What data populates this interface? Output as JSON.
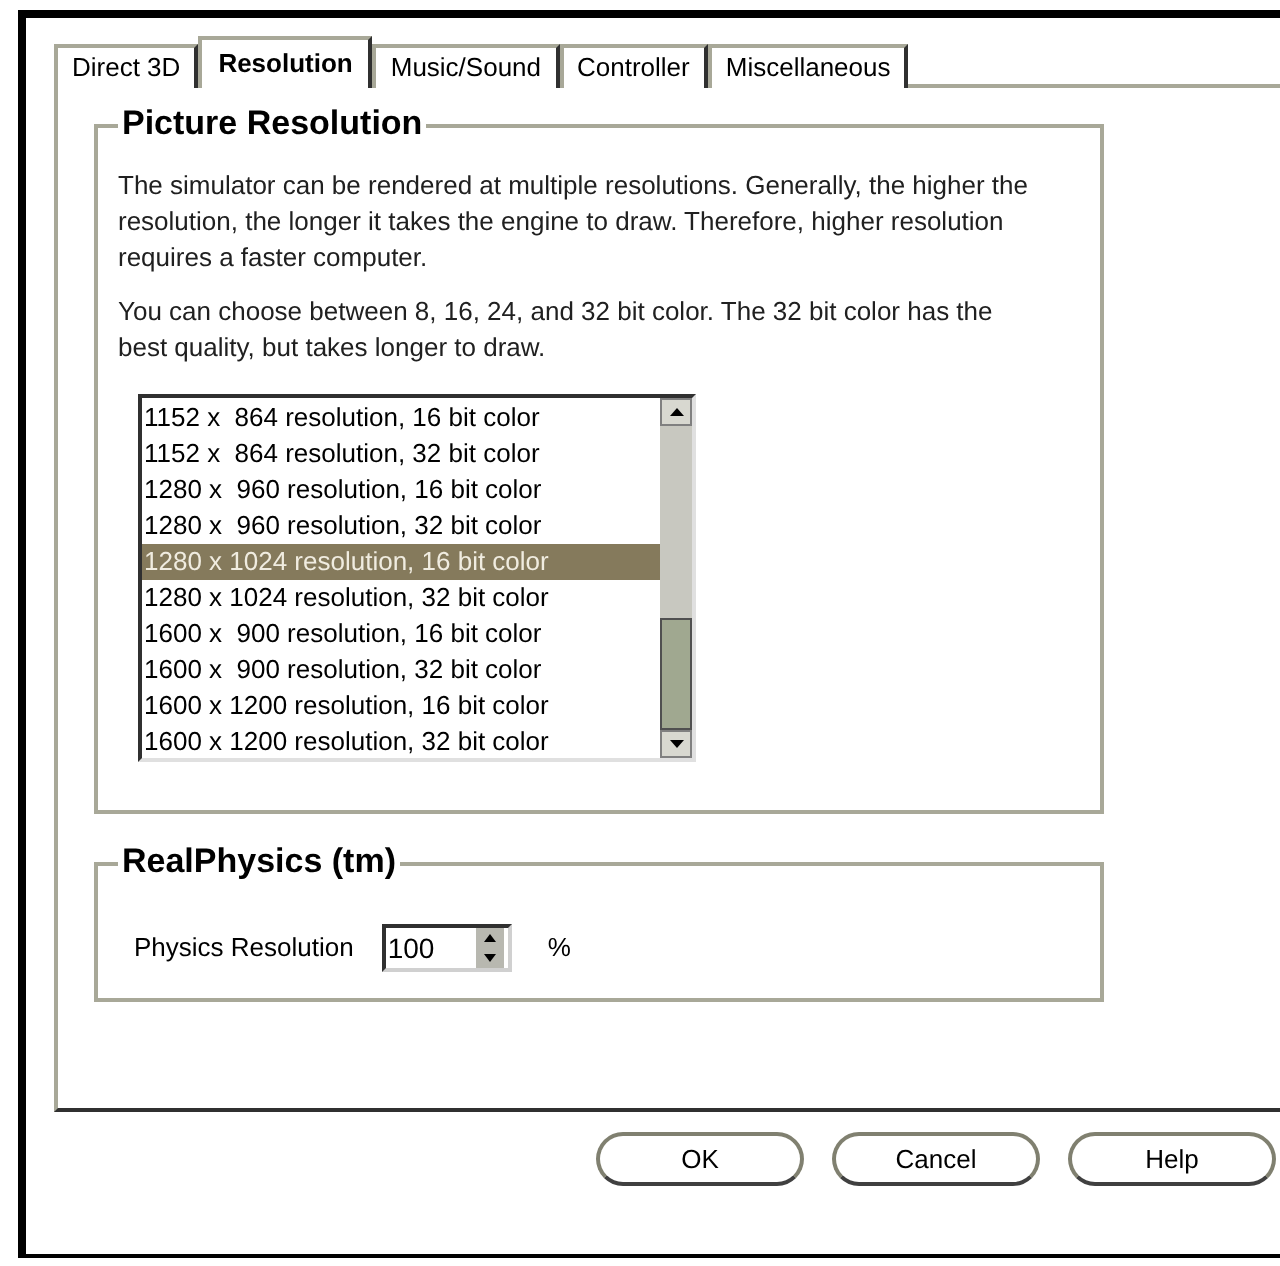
{
  "tabs": [
    {
      "label": "Direct 3D",
      "selected": false
    },
    {
      "label": "Resolution",
      "selected": true
    },
    {
      "label": "Music/Sound",
      "selected": false
    },
    {
      "label": "Controller",
      "selected": false
    },
    {
      "label": "Miscellaneous",
      "selected": false
    }
  ],
  "picture_resolution": {
    "title": "Picture Resolution",
    "paragraphs": [
      "The simulator can be rendered at multiple resolutions.  Generally, the higher the resolution, the longer it takes the engine to draw.  Therefore, higher resolution requires a faster computer.",
      "You can choose between 8, 16, 24, and 32  bit color.  The 32 bit color has the best quality, but takes longer to draw."
    ],
    "resolutions": [
      {
        "label": "1152 x  864 resolution, 16 bit color",
        "selected": false
      },
      {
        "label": "1152 x  864 resolution, 32 bit color",
        "selected": false
      },
      {
        "label": "1280 x  960 resolution, 16 bit color",
        "selected": false
      },
      {
        "label": "1280 x  960 resolution, 32 bit color",
        "selected": false
      },
      {
        "label": "1280 x 1024 resolution, 16 bit color",
        "selected": true
      },
      {
        "label": "1280 x 1024 resolution, 32 bit color",
        "selected": false
      },
      {
        "label": "1600 x  900 resolution, 16 bit color",
        "selected": false
      },
      {
        "label": "1600 x  900 resolution, 32 bit color",
        "selected": false
      },
      {
        "label": "1600 x 1200 resolution, 16 bit color",
        "selected": false
      },
      {
        "label": "1600 x 1200 resolution, 32 bit color",
        "selected": false
      }
    ]
  },
  "real_physics": {
    "title": "RealPhysics (tm)",
    "label": "Physics Resolution",
    "value": "100",
    "unit": "%"
  },
  "buttons": [
    "OK",
    "Cancel",
    "Help"
  ]
}
